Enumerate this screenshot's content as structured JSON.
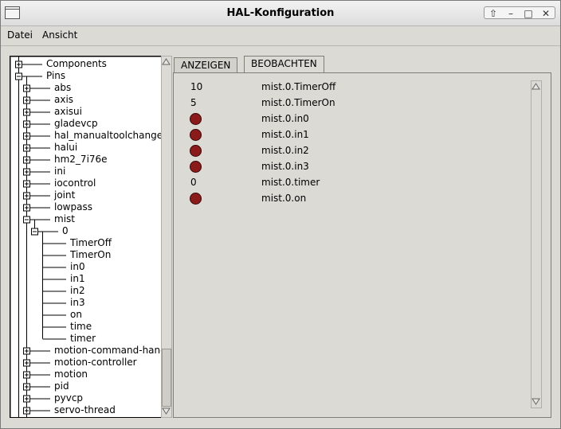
{
  "window": {
    "title": "HAL-Konfiguration",
    "buttons": {
      "up": "⇧",
      "minimize": "–",
      "maximize": "□",
      "close": "✕"
    }
  },
  "menu": {
    "file": "Datei",
    "view": "Ansicht"
  },
  "tree": {
    "rows": [
      {
        "label": "Components",
        "level": 0,
        "expander": "plus"
      },
      {
        "label": "Pins",
        "level": 0,
        "expander": "minus"
      },
      {
        "label": "abs",
        "level": 1,
        "expander": "plus"
      },
      {
        "label": "axis",
        "level": 1,
        "expander": "plus"
      },
      {
        "label": "axisui",
        "level": 1,
        "expander": "plus"
      },
      {
        "label": "gladevcp",
        "level": 1,
        "expander": "plus"
      },
      {
        "label": "hal_manualtoolchange",
        "level": 1,
        "expander": "plus"
      },
      {
        "label": "halui",
        "level": 1,
        "expander": "plus"
      },
      {
        "label": "hm2_7i76e",
        "level": 1,
        "expander": "plus"
      },
      {
        "label": "ini",
        "level": 1,
        "expander": "plus"
      },
      {
        "label": "iocontrol",
        "level": 1,
        "expander": "plus"
      },
      {
        "label": "joint",
        "level": 1,
        "expander": "plus"
      },
      {
        "label": "lowpass",
        "level": 1,
        "expander": "plus"
      },
      {
        "label": "mist",
        "level": 1,
        "expander": "minus"
      },
      {
        "label": "0",
        "level": 2,
        "expander": "minus"
      },
      {
        "label": "TimerOff",
        "level": 3,
        "expander": "none"
      },
      {
        "label": "TimerOn",
        "level": 3,
        "expander": "none"
      },
      {
        "label": "in0",
        "level": 3,
        "expander": "none"
      },
      {
        "label": "in1",
        "level": 3,
        "expander": "none"
      },
      {
        "label": "in2",
        "level": 3,
        "expander": "none"
      },
      {
        "label": "in3",
        "level": 3,
        "expander": "none"
      },
      {
        "label": "on",
        "level": 3,
        "expander": "none"
      },
      {
        "label": "time",
        "level": 3,
        "expander": "none"
      },
      {
        "label": "timer",
        "level": 3,
        "expander": "none"
      },
      {
        "label": "motion-command-handler",
        "level": 1,
        "expander": "plus"
      },
      {
        "label": "motion-controller",
        "level": 1,
        "expander": "plus"
      },
      {
        "label": "motion",
        "level": 1,
        "expander": "plus"
      },
      {
        "label": "pid",
        "level": 1,
        "expander": "plus"
      },
      {
        "label": "pyvcp",
        "level": 1,
        "expander": "plus"
      },
      {
        "label": "servo-thread",
        "level": 1,
        "expander": "plus"
      }
    ]
  },
  "tabs": [
    {
      "label": "ANZEIGEN",
      "active": false
    },
    {
      "label": "BEOBACHTEN",
      "active": true
    }
  ],
  "watch": {
    "led_color": "#8b1a1a",
    "items": [
      {
        "value": "10",
        "kind": "number",
        "name": "mist.0.TimerOff"
      },
      {
        "value": "5",
        "kind": "number",
        "name": "mist.0.TimerOn"
      },
      {
        "value": "",
        "kind": "led",
        "name": "mist.0.in0"
      },
      {
        "value": "",
        "kind": "led",
        "name": "mist.0.in1"
      },
      {
        "value": "",
        "kind": "led",
        "name": "mist.0.in2"
      },
      {
        "value": "",
        "kind": "led",
        "name": "mist.0.in3"
      },
      {
        "value": "0",
        "kind": "number",
        "name": "mist.0.timer"
      },
      {
        "value": "",
        "kind": "led",
        "name": "mist.0.on"
      }
    ]
  }
}
